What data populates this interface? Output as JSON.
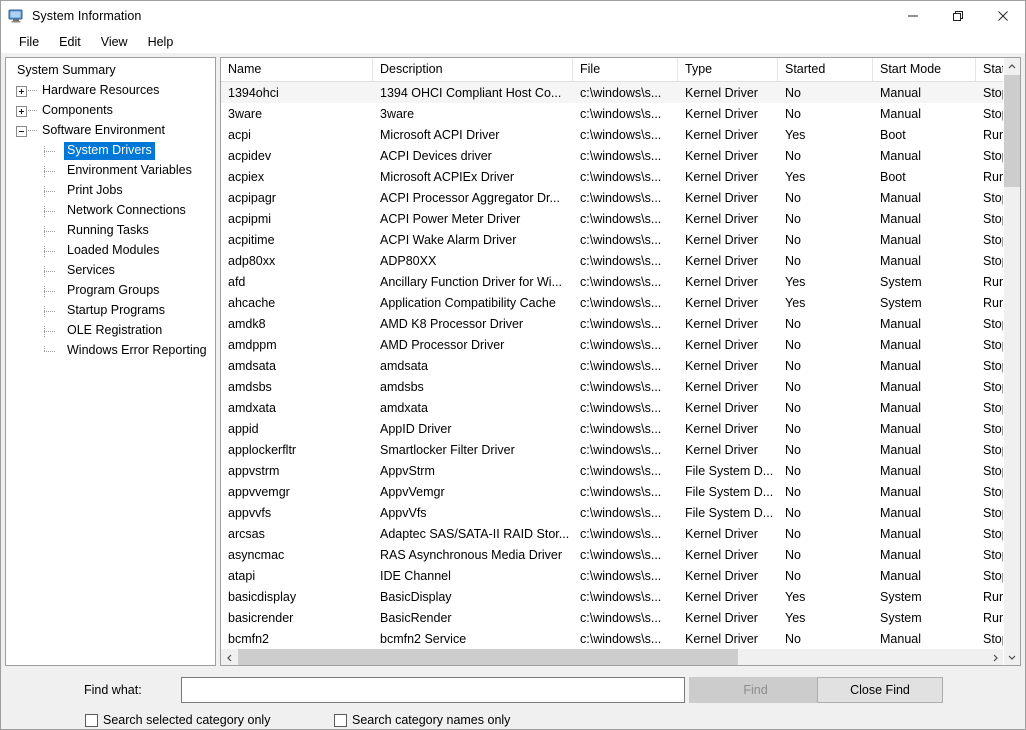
{
  "window": {
    "title": "System Information",
    "app_icon": "computer-monitor-icon",
    "controls": {
      "minimize": "minimize-icon",
      "restore": "restore-icon",
      "close": "close-icon"
    }
  },
  "menubar": {
    "items": [
      "File",
      "Edit",
      "View",
      "Help"
    ]
  },
  "tree": {
    "nodes": [
      {
        "label": "System Summary",
        "level": 0,
        "toggle": "none",
        "selected": false
      },
      {
        "label": "Hardware Resources",
        "level": 1,
        "toggle": "plus",
        "selected": false
      },
      {
        "label": "Components",
        "level": 1,
        "toggle": "plus",
        "selected": false
      },
      {
        "label": "Software Environment",
        "level": 1,
        "toggle": "minus",
        "selected": false
      },
      {
        "label": "System Drivers",
        "level": 2,
        "toggle": "none",
        "selected": true
      },
      {
        "label": "Environment Variables",
        "level": 2,
        "toggle": "none",
        "selected": false
      },
      {
        "label": "Print Jobs",
        "level": 2,
        "toggle": "none",
        "selected": false
      },
      {
        "label": "Network Connections",
        "level": 2,
        "toggle": "none",
        "selected": false
      },
      {
        "label": "Running Tasks",
        "level": 2,
        "toggle": "none",
        "selected": false
      },
      {
        "label": "Loaded Modules",
        "level": 2,
        "toggle": "none",
        "selected": false
      },
      {
        "label": "Services",
        "level": 2,
        "toggle": "none",
        "selected": false
      },
      {
        "label": "Program Groups",
        "level": 2,
        "toggle": "none",
        "selected": false
      },
      {
        "label": "Startup Programs",
        "level": 2,
        "toggle": "none",
        "selected": false
      },
      {
        "label": "OLE Registration",
        "level": 2,
        "toggle": "none",
        "selected": false
      },
      {
        "label": "Windows Error Reporting",
        "level": 2,
        "toggle": "none",
        "selected": false
      }
    ]
  },
  "list": {
    "columns": [
      "Name",
      "Description",
      "File",
      "Type",
      "Started",
      "Start Mode",
      "State"
    ],
    "rows": [
      {
        "name": "1394ohci",
        "description": "1394 OHCI Compliant Host Co...",
        "file": "c:\\windows\\s...",
        "type": "Kernel Driver",
        "started": "No",
        "start_mode": "Manual",
        "state": "Stop",
        "highlight": true
      },
      {
        "name": "3ware",
        "description": "3ware",
        "file": "c:\\windows\\s...",
        "type": "Kernel Driver",
        "started": "No",
        "start_mode": "Manual",
        "state": "Stop",
        "highlight": false
      },
      {
        "name": "acpi",
        "description": "Microsoft ACPI Driver",
        "file": "c:\\windows\\s...",
        "type": "Kernel Driver",
        "started": "Yes",
        "start_mode": "Boot",
        "state": "Runr",
        "highlight": false
      },
      {
        "name": "acpidev",
        "description": "ACPI Devices driver",
        "file": "c:\\windows\\s...",
        "type": "Kernel Driver",
        "started": "No",
        "start_mode": "Manual",
        "state": "Stop",
        "highlight": false
      },
      {
        "name": "acpiex",
        "description": "Microsoft ACPIEx Driver",
        "file": "c:\\windows\\s...",
        "type": "Kernel Driver",
        "started": "Yes",
        "start_mode": "Boot",
        "state": "Runr",
        "highlight": false
      },
      {
        "name": "acpipagr",
        "description": "ACPI Processor Aggregator Dr...",
        "file": "c:\\windows\\s...",
        "type": "Kernel Driver",
        "started": "No",
        "start_mode": "Manual",
        "state": "Stop",
        "highlight": false
      },
      {
        "name": "acpipmi",
        "description": "ACPI Power Meter Driver",
        "file": "c:\\windows\\s...",
        "type": "Kernel Driver",
        "started": "No",
        "start_mode": "Manual",
        "state": "Stop",
        "highlight": false
      },
      {
        "name": "acpitime",
        "description": "ACPI Wake Alarm Driver",
        "file": "c:\\windows\\s...",
        "type": "Kernel Driver",
        "started": "No",
        "start_mode": "Manual",
        "state": "Stop",
        "highlight": false
      },
      {
        "name": "adp80xx",
        "description": "ADP80XX",
        "file": "c:\\windows\\s...",
        "type": "Kernel Driver",
        "started": "No",
        "start_mode": "Manual",
        "state": "Stop",
        "highlight": false
      },
      {
        "name": "afd",
        "description": "Ancillary Function Driver for Wi...",
        "file": "c:\\windows\\s...",
        "type": "Kernel Driver",
        "started": "Yes",
        "start_mode": "System",
        "state": "Runr",
        "highlight": false
      },
      {
        "name": "ahcache",
        "description": "Application Compatibility Cache",
        "file": "c:\\windows\\s...",
        "type": "Kernel Driver",
        "started": "Yes",
        "start_mode": "System",
        "state": "Runr",
        "highlight": false
      },
      {
        "name": "amdk8",
        "description": "AMD K8 Processor Driver",
        "file": "c:\\windows\\s...",
        "type": "Kernel Driver",
        "started": "No",
        "start_mode": "Manual",
        "state": "Stop",
        "highlight": false
      },
      {
        "name": "amdppm",
        "description": "AMD Processor Driver",
        "file": "c:\\windows\\s...",
        "type": "Kernel Driver",
        "started": "No",
        "start_mode": "Manual",
        "state": "Stop",
        "highlight": false
      },
      {
        "name": "amdsata",
        "description": "amdsata",
        "file": "c:\\windows\\s...",
        "type": "Kernel Driver",
        "started": "No",
        "start_mode": "Manual",
        "state": "Stop",
        "highlight": false
      },
      {
        "name": "amdsbs",
        "description": "amdsbs",
        "file": "c:\\windows\\s...",
        "type": "Kernel Driver",
        "started": "No",
        "start_mode": "Manual",
        "state": "Stop",
        "highlight": false
      },
      {
        "name": "amdxata",
        "description": "amdxata",
        "file": "c:\\windows\\s...",
        "type": "Kernel Driver",
        "started": "No",
        "start_mode": "Manual",
        "state": "Stop",
        "highlight": false
      },
      {
        "name": "appid",
        "description": "AppID Driver",
        "file": "c:\\windows\\s...",
        "type": "Kernel Driver",
        "started": "No",
        "start_mode": "Manual",
        "state": "Stop",
        "highlight": false
      },
      {
        "name": "applockerfltr",
        "description": "Smartlocker Filter Driver",
        "file": "c:\\windows\\s...",
        "type": "Kernel Driver",
        "started": "No",
        "start_mode": "Manual",
        "state": "Stop",
        "highlight": false
      },
      {
        "name": "appvstrm",
        "description": "AppvStrm",
        "file": "c:\\windows\\s...",
        "type": "File System D...",
        "started": "No",
        "start_mode": "Manual",
        "state": "Stop",
        "highlight": false
      },
      {
        "name": "appvvemgr",
        "description": "AppvVemgr",
        "file": "c:\\windows\\s...",
        "type": "File System D...",
        "started": "No",
        "start_mode": "Manual",
        "state": "Stop",
        "highlight": false
      },
      {
        "name": "appvvfs",
        "description": "AppvVfs",
        "file": "c:\\windows\\s...",
        "type": "File System D...",
        "started": "No",
        "start_mode": "Manual",
        "state": "Stop",
        "highlight": false
      },
      {
        "name": "arcsas",
        "description": "Adaptec SAS/SATA-II RAID Stor...",
        "file": "c:\\windows\\s...",
        "type": "Kernel Driver",
        "started": "No",
        "start_mode": "Manual",
        "state": "Stop",
        "highlight": false
      },
      {
        "name": "asyncmac",
        "description": "RAS Asynchronous Media Driver",
        "file": "c:\\windows\\s...",
        "type": "Kernel Driver",
        "started": "No",
        "start_mode": "Manual",
        "state": "Stop",
        "highlight": false
      },
      {
        "name": "atapi",
        "description": "IDE Channel",
        "file": "c:\\windows\\s...",
        "type": "Kernel Driver",
        "started": "No",
        "start_mode": "Manual",
        "state": "Stop",
        "highlight": false
      },
      {
        "name": "basicdisplay",
        "description": "BasicDisplay",
        "file": "c:\\windows\\s...",
        "type": "Kernel Driver",
        "started": "Yes",
        "start_mode": "System",
        "state": "Runr",
        "highlight": false
      },
      {
        "name": "basicrender",
        "description": "BasicRender",
        "file": "c:\\windows\\s...",
        "type": "Kernel Driver",
        "started": "Yes",
        "start_mode": "System",
        "state": "Runr",
        "highlight": false
      },
      {
        "name": "bcmfn2",
        "description": "bcmfn2 Service",
        "file": "c:\\windows\\s...",
        "type": "Kernel Driver",
        "started": "No",
        "start_mode": "Manual",
        "state": "Stop",
        "highlight": false
      }
    ]
  },
  "findbar": {
    "label": "Find what:",
    "input_value": "",
    "input_placeholder": "",
    "find_label": "Find",
    "close_find_label": "Close Find",
    "checkbox_selected_category": "Search selected category only",
    "checkbox_category_names": "Search category names only",
    "selected_category_checked": false,
    "category_names_checked": false
  },
  "colors": {
    "selection_blue": "#0078d7",
    "row_highlight": "#f5f5f5",
    "panel_bg": "#f0f0f0",
    "scrollbar_thumb": "#cdcdcd"
  }
}
